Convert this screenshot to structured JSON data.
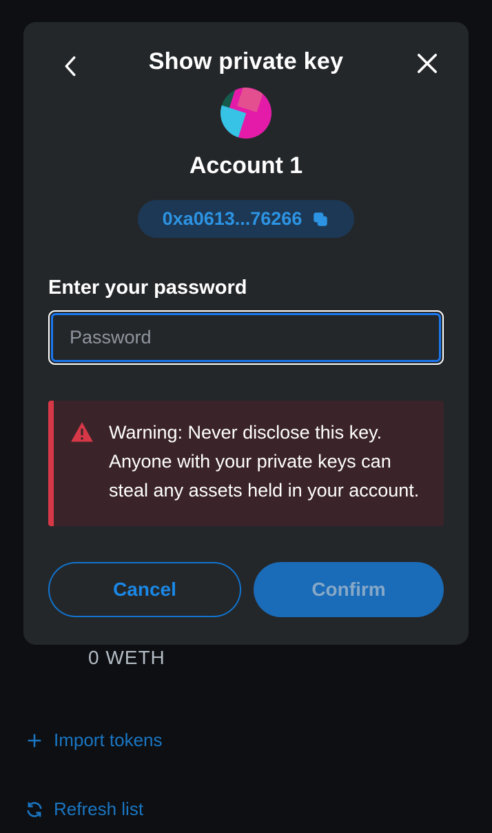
{
  "modal": {
    "title": "Show private key",
    "account_name": "Account 1",
    "address": "0xa0613...76266",
    "password_label": "Enter your password",
    "password_placeholder": "Password",
    "warning": "Warning: Never disclose this key. Anyone with your private keys can steal any assets held in your account.",
    "cancel_label": "Cancel",
    "confirm_label": "Confirm"
  },
  "background": {
    "token_balance": "0 WETH",
    "import_label": "Import tokens",
    "refresh_label": "Refresh list"
  }
}
